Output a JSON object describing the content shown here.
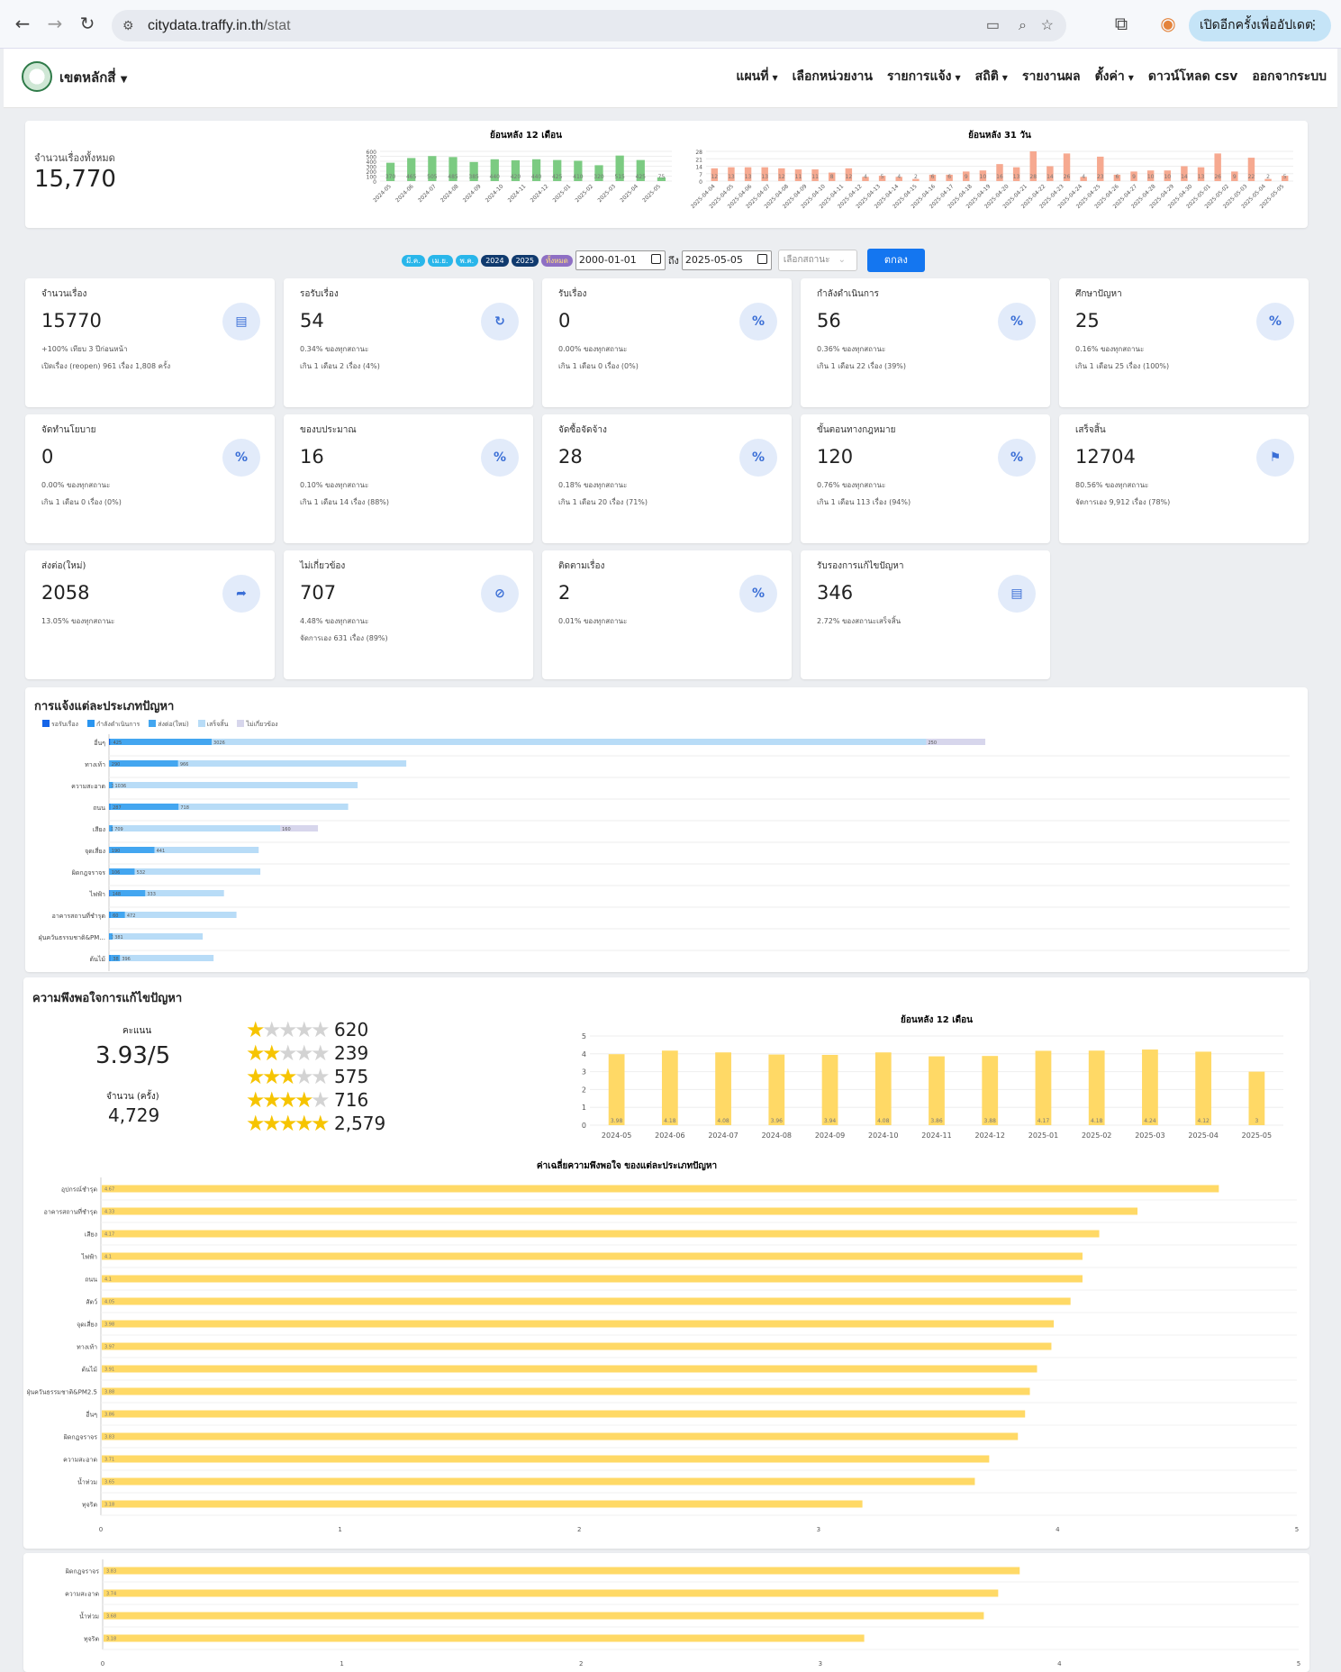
{
  "browser": {
    "url_host": "citydata.traffy.in.th",
    "url_path": "/stat",
    "update_button": "เปิดอีกครั้งเพื่ออัปเดต"
  },
  "app": {
    "district": "เขตหลักสี่",
    "menu": [
      "แผนที่",
      "เลือกหน่วยงาน",
      "รายการแจ้ง",
      "สถิติ",
      "รายงานผล",
      "ตั้งค่า",
      "ดาวน์โหลด csv",
      "ออกจากระบบ"
    ],
    "menu_dropdown": [
      true,
      false,
      true,
      true,
      false,
      true,
      false,
      false
    ]
  },
  "summary": {
    "total_label": "จำนวนเรื่องทั้งหมด",
    "total_value": "15,770"
  },
  "filter": {
    "chips": [
      "มี.ค.",
      "เม.ย.",
      "พ.ค.",
      "2024",
      "2025",
      "ทั้งหมด"
    ],
    "date_from": "2000-01-01",
    "to_label": "ถึง",
    "date_to": "2025-05-05",
    "status_placeholder": "เลือกสถานะ",
    "ok_button": "ตกลง"
  },
  "stats": [
    {
      "label": "จำนวนเรื่อง",
      "value": "15770",
      "sub1": "+100% เทียบ 3 ปีก่อนหน้า",
      "sub2": "เปิดเรื่อง (reopen) 961 เรื่อง 1,808 ครั้ง",
      "icon": "document-icon"
    },
    {
      "label": "รอรับเรื่อง",
      "value": "54",
      "sub1": "0.34% ของทุกสถานะ",
      "sub2": "เกิน 1 เดือน 2 เรื่อง (4%)",
      "icon": "refresh-icon"
    },
    {
      "label": "รับเรื่อง",
      "value": "0",
      "sub1": "0.00% ของทุกสถานะ",
      "sub2": "เกิน 1 เดือน 0 เรื่อง (0%)",
      "icon": "percent-icon"
    },
    {
      "label": "กำลังดำเนินการ",
      "value": "56",
      "sub1": "0.36% ของทุกสถานะ",
      "sub2": "เกิน 1 เดือน 22 เรื่อง (39%)",
      "icon": "percent-icon"
    },
    {
      "label": "ศึกษาปัญหา",
      "value": "25",
      "sub1": "0.16% ของทุกสถานะ",
      "sub2": "เกิน 1 เดือน 25 เรื่อง (100%)",
      "icon": "percent-icon"
    },
    {
      "label": "จัดทำนโยบาย",
      "value": "0",
      "sub1": "0.00% ของทุกสถานะ",
      "sub2": "เกิน 1 เดือน 0 เรื่อง (0%)",
      "icon": "percent-icon"
    },
    {
      "label": "ของบประมาณ",
      "value": "16",
      "sub1": "0.10% ของทุกสถานะ",
      "sub2": "เกิน 1 เดือน 14 เรื่อง (88%)",
      "icon": "percent-icon"
    },
    {
      "label": "จัดซื้อจัดจ้าง",
      "value": "28",
      "sub1": "0.18% ของทุกสถานะ",
      "sub2": "เกิน 1 เดือน 20 เรื่อง (71%)",
      "icon": "percent-icon"
    },
    {
      "label": "ขั้นตอนทางกฎหมาย",
      "value": "120",
      "sub1": "0.76% ของทุกสถานะ",
      "sub2": "เกิน 1 เดือน 113 เรื่อง (94%)",
      "icon": "percent-icon"
    },
    {
      "label": "เสร็จสิ้น",
      "value": "12704",
      "sub1": "80.56% ของทุกสถานะ",
      "sub2": "จัดการเอง 9,912 เรื่อง (78%)",
      "icon": "checkered-flag-icon"
    },
    {
      "label": "ส่งต่อ(ใหม่)",
      "value": "2058",
      "sub1": "13.05% ของทุกสถานะ",
      "sub2": "",
      "icon": "forward-icon"
    },
    {
      "label": "ไม่เกี่ยวข้อง",
      "value": "707",
      "sub1": "4.48% ของทุกสถานะ",
      "sub2": "จัดการเอง 631 เรื่อง (89%)",
      "icon": "hidden-icon"
    },
    {
      "label": "ติดตามเรื่อง",
      "value": "2",
      "sub1": "0.01% ของทุกสถานะ",
      "sub2": "",
      "icon": "percent-icon"
    },
    {
      "label": "รับรองการแก้ไขปัญหา",
      "value": "346",
      "sub1": "2.72% ของสถานะเสร็จสิ้น",
      "sub2": "",
      "icon": "document-icon"
    }
  ],
  "satisfaction": {
    "title": "ความพึงพอใจการแก้ไขปัญหา",
    "score_label": "คะแนน",
    "score": "3.93/5",
    "count_label": "จำนวน (ครั้ง)",
    "count": "4,729",
    "stars": [
      {
        "n": 1,
        "count": "620"
      },
      {
        "n": 2,
        "count": "239"
      },
      {
        "n": 3,
        "count": "575"
      },
      {
        "n": 4,
        "count": "716"
      },
      {
        "n": 5,
        "count": "2,579"
      }
    ]
  },
  "chart_data": [
    {
      "id": "m12",
      "type": "bar",
      "title": "ย้อนหลัง 12 เดือน",
      "color": "#7ccb82",
      "categories": [
        "2024-05",
        "2024-06",
        "2024-07",
        "2024-08",
        "2024-09",
        "2024-10",
        "2024-11",
        "2024-12",
        "2025-01",
        "2025-02",
        "2025-03",
        "2025-04",
        "2025-05"
      ],
      "values": [
        370,
        465,
        505,
        485,
        385,
        440,
        420,
        440,
        425,
        410,
        320,
        515,
        425,
        75
      ],
      "ylim": [
        0,
        600
      ],
      "yticks": [
        0,
        100,
        200,
        300,
        400,
        500,
        600
      ]
    },
    {
      "id": "d31",
      "type": "bar",
      "title": "ย้อนหลัง 31 วัน",
      "color": "#f6a990",
      "categories": [
        "2025-04-04",
        "2025-04-05",
        "2025-04-06",
        "2025-04-07",
        "2025-04-08",
        "2025-04-09",
        "2025-04-10",
        "2025-04-11",
        "2025-04-12",
        "2025-04-13",
        "2025-04-14",
        "2025-04-15",
        "2025-04-16",
        "2025-04-17",
        "2025-04-18",
        "2025-04-19",
        "2025-04-20",
        "2025-04-21",
        "2025-04-22",
        "2025-04-23",
        "2025-04-24",
        "2025-04-25",
        "2025-04-26",
        "2025-04-27",
        "2025-04-28",
        "2025-04-29",
        "2025-04-30",
        "2025-05-01",
        "2025-05-02",
        "2025-05-03",
        "2025-05-04",
        "2025-05-05"
      ],
      "values": [
        12,
        13,
        13,
        13,
        12,
        11,
        11,
        8,
        12,
        4,
        5,
        4,
        2,
        6,
        6,
        9,
        10,
        16,
        13,
        28,
        14,
        26,
        4,
        23,
        6,
        9,
        10,
        10,
        14,
        13,
        26,
        9,
        22,
        2,
        5
      ],
      "ylim": [
        0,
        28
      ],
      "yticks": [
        0,
        7,
        14,
        21,
        28
      ]
    },
    {
      "id": "types",
      "type": "bar",
      "orientation": "horizontal",
      "stacked": true,
      "title": "การแจ้งแต่ละประเภทปัญหา",
      "series_names": [
        "รอรับเรื่อง",
        "กำลังดำเนินการ",
        "ส่งต่อ(ใหม่)",
        "เสร็จสิ้น",
        "ไม่เกี่ยวข้อง"
      ],
      "series_colors": [
        "#1565e8",
        "#2a95f0",
        "#43a6f0",
        "#b8dcf7",
        "#d7d6ec"
      ],
      "categories": [
        "อื่นๆ",
        "ทางเท้า",
        "ความสะอาด",
        "ถนน",
        "เสียง",
        "จุดเสี่ยง",
        "ผิดกฎจราจร",
        "ไฟฟ้า",
        "อาคารสถานที่ชำรุด",
        "ฝุ่นควันธรรมชาติ&PM...",
        "ต้นไม้"
      ],
      "values": [
        [
          4,
          6,
          425,
          3026,
          250
        ],
        [
          0,
          3,
          290,
          966,
          0
        ],
        [
          0,
          2,
          15,
          1036,
          0
        ],
        [
          0,
          8,
          287,
          718,
          0
        ],
        [
          0,
          1,
          15,
          709,
          160
        ],
        [
          0,
          3,
          190,
          441,
          0
        ],
        [
          0,
          3,
          106,
          532,
          0
        ],
        [
          3,
          3,
          148,
          333,
          0
        ],
        [
          0,
          8,
          60,
          472,
          0
        ],
        [
          0,
          2,
          14,
          381,
          0
        ],
        [
          0,
          9,
          38,
          396,
          0
        ]
      ],
      "xlim": [
        0,
        5000
      ]
    },
    {
      "id": "sat12",
      "type": "bar",
      "title": "ย้อนหลัง 12 เดือน",
      "color": "#ffd966",
      "categories": [
        "2024-05",
        "2024-06",
        "2024-07",
        "2024-08",
        "2024-09",
        "2024-10",
        "2024-11",
        "2024-12",
        "2025-01",
        "2025-02",
        "2025-03",
        "2025-04",
        "2025-05"
      ],
      "values": [
        3.98,
        4.18,
        4.08,
        3.96,
        3.94,
        4.08,
        3.86,
        3.88,
        4.17,
        4.18,
        4.24,
        4.12,
        3.0
      ],
      "ylim": [
        0,
        5
      ],
      "yticks": [
        0,
        1,
        2,
        3,
        4,
        5
      ]
    },
    {
      "id": "avg",
      "type": "bar",
      "orientation": "horizontal",
      "title": "ค่าเฉลี่ยความพึงพอใจ ของแต่ละประเภทปัญหา",
      "color": "#ffd966",
      "categories": [
        "อุปกรณ์ชำรุด",
        "อาคารสถานที่ชำรุด",
        "เสียง",
        "ไฟฟ้า",
        "ถนน",
        "สัตว์",
        "จุดเสี่ยง",
        "ทางเท้า",
        "ต้นไม้",
        "ฝุ่นควันธรรมชาติ&PM2.5",
        "อื่นๆ",
        "ผิดกฎจราจร",
        "ความสะอาด",
        "น้ำท่วม",
        "ทุจริต"
      ],
      "values": [
        4.67,
        4.33,
        4.17,
        4.1,
        4.1,
        4.05,
        3.98,
        3.97,
        3.91,
        3.88,
        3.86,
        3.83,
        3.71,
        3.65,
        3.18
      ],
      "xlim": [
        0,
        5
      ],
      "xticks": [
        0,
        1,
        2,
        3,
        4,
        5
      ]
    },
    {
      "id": "avg2",
      "type": "bar",
      "orientation": "horizontal",
      "color": "#ffd966",
      "categories": [
        "ผิดกฎจราจร",
        "ความสะอาด",
        "น้ำท่วม",
        "ทุจริต"
      ],
      "values": [
        3.83,
        3.74,
        3.68,
        3.18
      ],
      "xlim": [
        0,
        5
      ],
      "xticks": [
        0,
        1,
        2,
        3,
        4,
        5
      ]
    }
  ]
}
